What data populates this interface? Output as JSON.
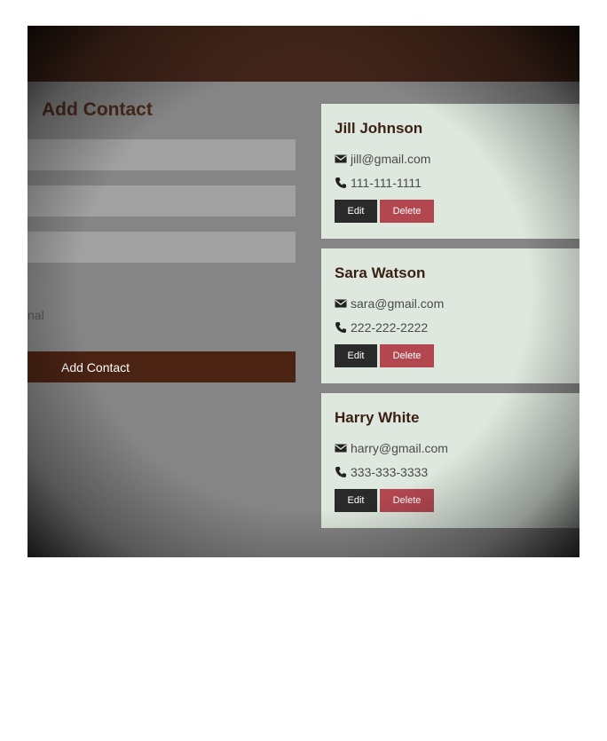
{
  "form": {
    "title": "Add Contact",
    "fields": [
      {
        "value": "",
        "placeholder": ""
      },
      {
        "value": "",
        "placeholder": ""
      },
      {
        "value": "",
        "placeholder": ""
      }
    ],
    "type_label_partial": "nal",
    "submit_label": "Add Contact"
  },
  "contacts": [
    {
      "name": "Jill Johnson",
      "email": "jill@gmail.com",
      "phone": "111-111-1111",
      "edit_label": "Edit",
      "delete_label": "Delete"
    },
    {
      "name": "Sara Watson",
      "email": "sara@gmail.com",
      "phone": "222-222-2222",
      "edit_label": "Edit",
      "delete_label": "Delete"
    },
    {
      "name": "Harry White",
      "email": "harry@gmail.com",
      "phone": "333-333-3333",
      "edit_label": "Edit",
      "delete_label": "Delete"
    }
  ],
  "icons": {
    "email": "envelope-icon",
    "phone": "phone-icon"
  },
  "colors": {
    "navbar": "#4a2a1c",
    "primary_button": "#4a2313",
    "edit_button": "#2a2a2a",
    "delete_button": "#b34750",
    "card_background": "#dfe8df"
  }
}
